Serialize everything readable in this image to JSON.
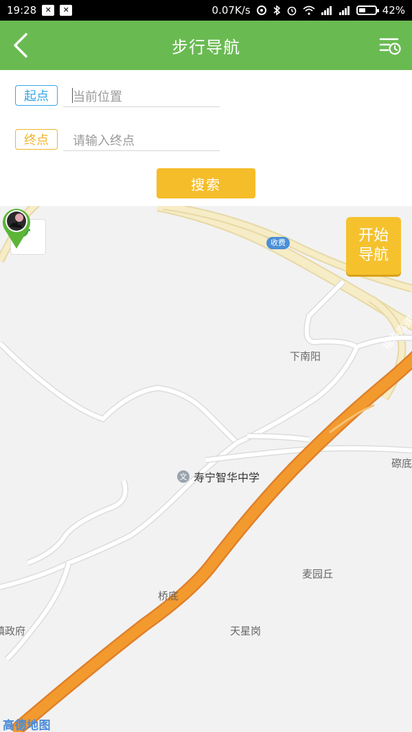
{
  "status_bar": {
    "time": "19:28",
    "network_speed": "0.07K/s",
    "battery_percent": "42%",
    "battery_level": 0.42
  },
  "header": {
    "title": "步行导航"
  },
  "form": {
    "start_tag": "起点",
    "start_placeholder": "当前位置",
    "end_tag": "终点",
    "end_placeholder": "请输入终点",
    "search_label": "搜索"
  },
  "map": {
    "start_nav_line1": "开始",
    "start_nav_line2": "导航",
    "labels": {
      "toll": "收费",
      "xia_nan_yang": "下南阳",
      "highway": "福寿高速",
      "kou_di": "磜底",
      "school": "寿宁智华中学",
      "mai_yuan_qiu": "麦园丘",
      "qiao_di": "桥底",
      "zhen_zheng_fu": "镇政府",
      "tian_xing_gang": "天星岗"
    },
    "logo": "高德地图",
    "colors": {
      "highway_main": "#f29a2e",
      "expressway": "#f5e6b3",
      "minor_road": "#ffffff"
    }
  }
}
